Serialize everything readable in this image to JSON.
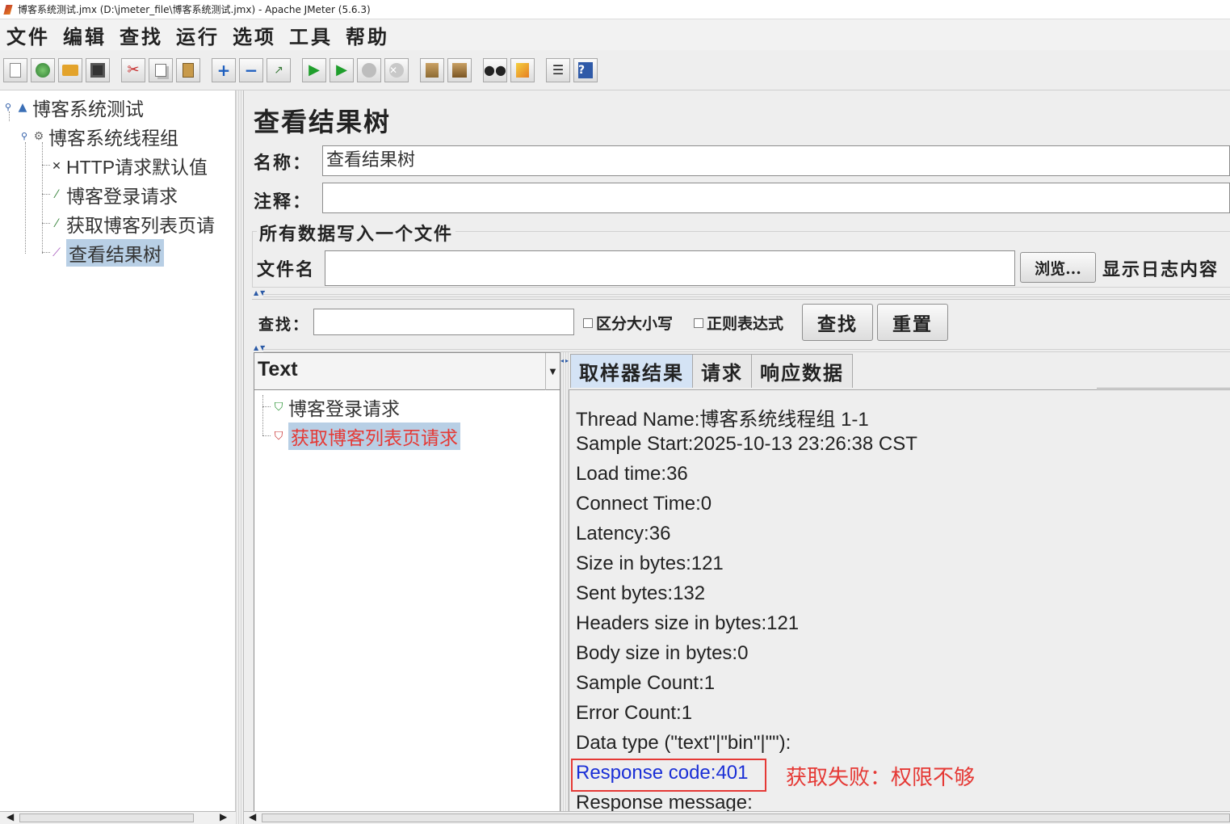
{
  "window": {
    "title": "博客系统测试.jmx (D:\\jmeter_file\\博客系统测试.jmx) - Apache JMeter (5.6.3)"
  },
  "menu": [
    "文件",
    "编辑",
    "查找",
    "运行",
    "选项",
    "工具",
    "帮助"
  ],
  "toolbar": [
    {
      "name": "new",
      "icon": "new-file-icon"
    },
    {
      "name": "templates",
      "icon": "templates-icon"
    },
    {
      "name": "open",
      "icon": "open-folder-icon"
    },
    {
      "name": "save",
      "icon": "save-icon"
    },
    {
      "name": "cut",
      "icon": "cut-icon"
    },
    {
      "name": "copy",
      "icon": "copy-icon"
    },
    {
      "name": "paste",
      "icon": "paste-icon"
    },
    {
      "name": "expand",
      "icon": "expand-icon"
    },
    {
      "name": "collapse",
      "icon": "collapse-icon"
    },
    {
      "name": "toggle",
      "icon": "toggle-icon"
    },
    {
      "name": "start",
      "icon": "start-icon"
    },
    {
      "name": "start-no-pause",
      "icon": "start-no-pauses-icon"
    },
    {
      "name": "stop",
      "icon": "stop-icon"
    },
    {
      "name": "shutdown",
      "icon": "shutdown-icon"
    },
    {
      "name": "clear",
      "icon": "clear-icon"
    },
    {
      "name": "clear-all",
      "icon": "clear-all-icon"
    },
    {
      "name": "search",
      "icon": "binoculars-icon"
    },
    {
      "name": "reset-search",
      "icon": "broom-icon"
    },
    {
      "name": "function-helper",
      "icon": "function-list-icon"
    },
    {
      "name": "help",
      "icon": "help-icon"
    }
  ],
  "tree": {
    "root": "博客系统测试",
    "thread_group": "博客系统线程组",
    "items": [
      "HTTP请求默认值",
      "博客登录请求",
      "获取博客列表页请",
      "查看结果树"
    ],
    "selected": "查看结果树"
  },
  "panel": {
    "title": "查看结果树",
    "name_label": "名称：",
    "name_value": "查看结果树",
    "comment_label": "注释：",
    "comment_value": "",
    "file_group": "所有数据写入一个文件",
    "filename_label": "文件名",
    "filename_value": "",
    "browse_button": "浏览...",
    "log_label": "显示日志内容"
  },
  "search": {
    "label": "查找：",
    "value": "",
    "case_label": "区分大小写",
    "regex_label": "正则表达式",
    "find_button": "查找",
    "reset_button": "重置"
  },
  "results": {
    "renderer": "Text",
    "samples": [
      {
        "label": "博客登录请求",
        "status": "success"
      },
      {
        "label": "获取博客列表页请求",
        "status": "error"
      }
    ]
  },
  "tabs": [
    "取样器结果",
    "请求",
    "响应数据"
  ],
  "sampler_result": {
    "lines": [
      "Thread Name:博客系统线程组 1-1",
      "Sample Start:2025-10-13 23:26:38 CST",
      "Load time:36",
      "Connect Time:0",
      "Latency:36",
      "Size in bytes:121",
      "Sent bytes:132",
      "Headers size in bytes:121",
      "Body size in bytes:0",
      "Sample Count:1",
      "Error Count:1",
      "Data type (\"text\"|\"bin\"|\"\"):"
    ],
    "response_code": "Response code:401",
    "response_message": "Response message:",
    "annotation": "获取失败：权限不够"
  },
  "colors": {
    "selection": "#b8cfe5",
    "error_text": "#e53935",
    "highlight_blue": "#1a2fd6",
    "tab_active": "#d4e3f5"
  }
}
